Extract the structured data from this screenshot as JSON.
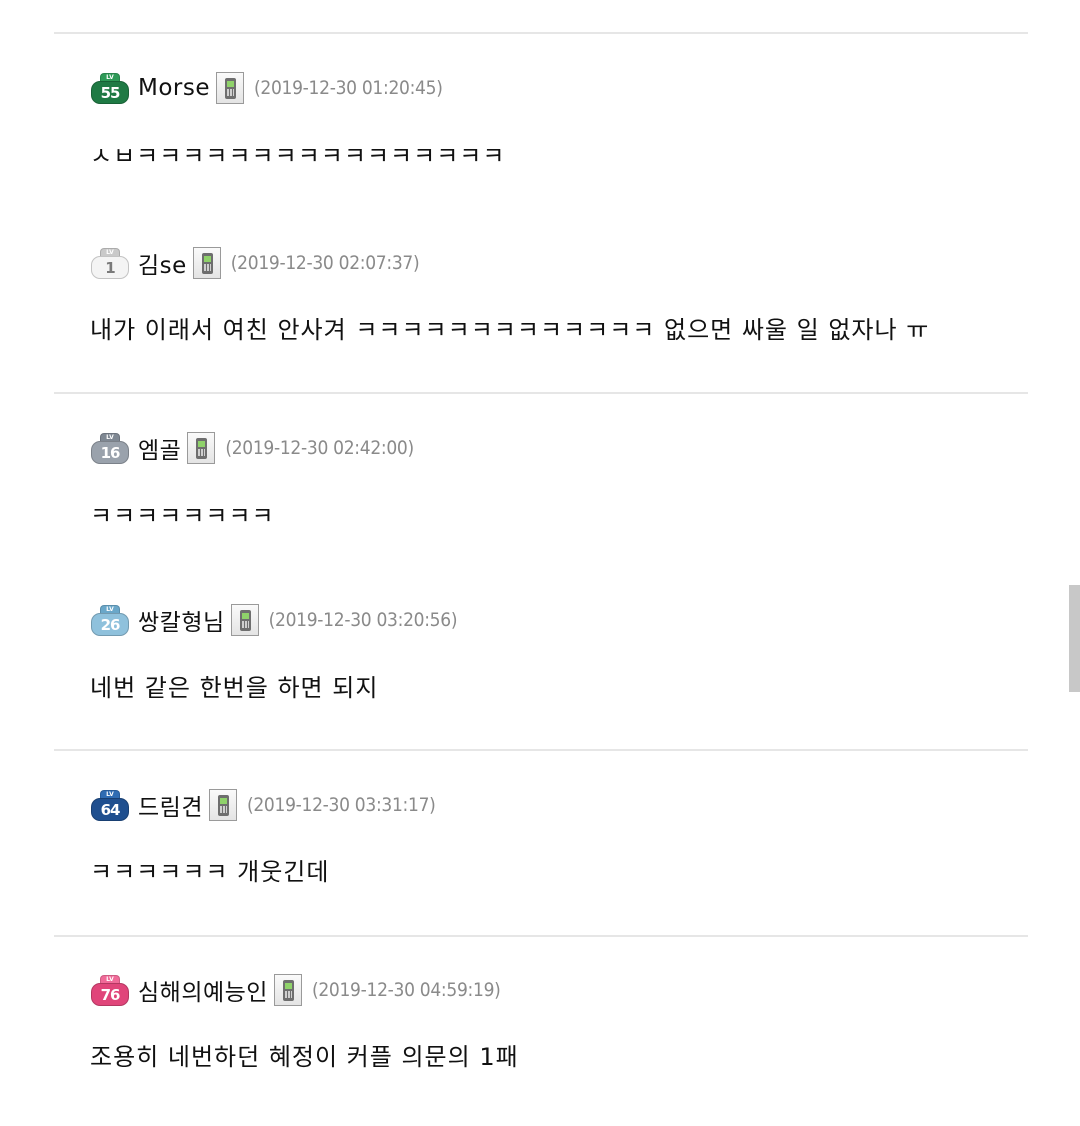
{
  "comments": [
    {
      "level": "55",
      "level_colors": {
        "base": "#1f7a44",
        "cap": "#2e9a57",
        "text": "#ffffff"
      },
      "nickname": "Morse",
      "device_icon": "mobile-phone-icon",
      "timestamp": "(2019-12-30 01:20:45)",
      "text": "ㅅㅂㅋㅋㅋㅋㅋㅋㅋㅋㅋㅋㅋㅋㅋㅋㅋㅋ"
    },
    {
      "level": "1",
      "level_colors": {
        "base": "#f4f4f4",
        "cap": "#c9c9c9",
        "text": "#7a7a7a"
      },
      "nickname": "김se",
      "device_icon": "mobile-phone-icon",
      "timestamp": "(2019-12-30 02:07:37)",
      "text": "내가 이래서 여친 안사겨 ㅋㅋㅋㅋㅋㅋㅋㅋㅋㅋㅋㅋㅋ 없으면 싸울 일 없자나 ㅠ"
    },
    {
      "level": "16",
      "level_colors": {
        "base": "#9aa2ac",
        "cap": "#7f8893",
        "text": "#ffffff"
      },
      "nickname": "엠골",
      "device_icon": "mobile-phone-icon",
      "timestamp": "(2019-12-30 02:42:00)",
      "text": "ㅋㅋㅋㅋㅋㅋㅋㅋ"
    },
    {
      "level": "26",
      "level_colors": {
        "base": "#8fc1dc",
        "cap": "#6aa7c9",
        "text": "#ffffff"
      },
      "nickname": "쌍칼형님",
      "device_icon": "mobile-phone-icon",
      "timestamp": "(2019-12-30 03:20:56)",
      "text": "네번 같은 한번을 하면 되지"
    },
    {
      "level": "64",
      "level_colors": {
        "base": "#1f4f8f",
        "cap": "#2f6cb3",
        "text": "#ffffff"
      },
      "nickname": "드림견",
      "device_icon": "mobile-phone-icon",
      "timestamp": "(2019-12-30 03:31:17)",
      "text": "ㅋㅋㅋㅋㅋㅋ 개웃긴데"
    },
    {
      "level": "76",
      "level_colors": {
        "base": "#e0457a",
        "cap": "#f06a98",
        "text": "#ffffff"
      },
      "nickname": "심해의예능인",
      "device_icon": "mobile-phone-icon",
      "timestamp": "(2019-12-30 04:59:19)",
      "text": "조용히 네번하던 혜정이 커플 의문의 1패"
    }
  ]
}
